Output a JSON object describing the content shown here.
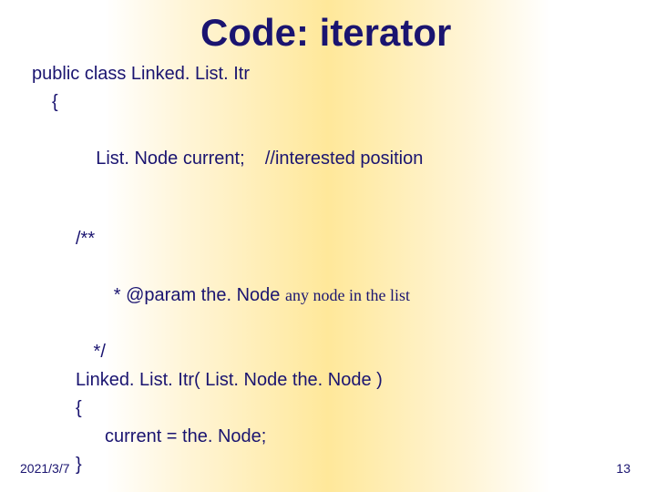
{
  "title": "Code: iterator",
  "code": {
    "line1": "public class Linked. List. Itr",
    "line2": "{",
    "line3a": "List. Node current;    ",
    "line3b": "//interested position",
    "line4": "/**",
    "line5a": " * @param the. Node ",
    "line5b": "any node in the list",
    "line6": " */",
    "line7": "Linked. List. Itr( List. Node the. Node )",
    "line8": "{",
    "line9": "current = the. Node;",
    "line10": "}"
  },
  "footer": {
    "date": "2021/3/7",
    "page": "13"
  }
}
